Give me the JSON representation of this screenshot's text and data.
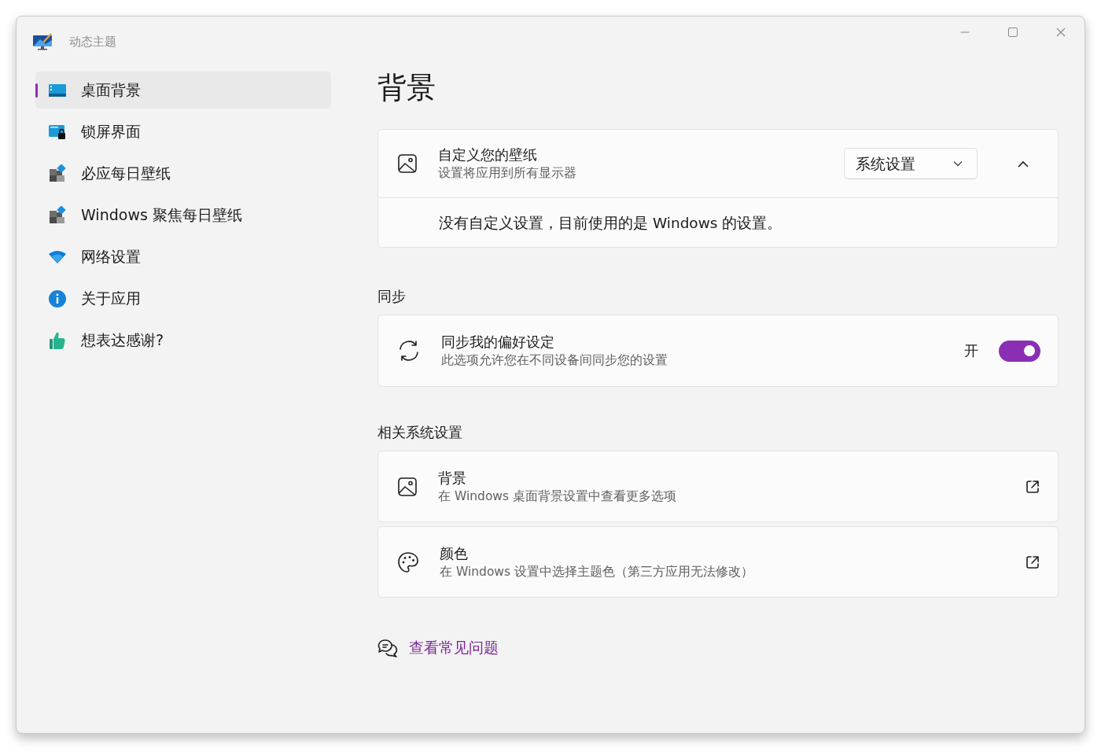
{
  "window": {
    "title": "动态主题"
  },
  "sidebar": {
    "items": [
      {
        "label": "桌面背景",
        "selected": true
      },
      {
        "label": "锁屏界面",
        "selected": false
      },
      {
        "label": "必应每日壁纸",
        "selected": false
      },
      {
        "label": "Windows 聚焦每日壁纸",
        "selected": false
      },
      {
        "label": "网络设置",
        "selected": false
      },
      {
        "label": "关于应用",
        "selected": false
      },
      {
        "label": "想表达感谢?",
        "selected": false
      }
    ]
  },
  "page": {
    "title": "背景"
  },
  "wallpaper_card": {
    "title": "自定义您的壁纸",
    "subtitle": "设置将应用到所有显示器",
    "dropdown": {
      "value": "系统设置"
    },
    "expanded": true,
    "message": "没有自定义设置，目前使用的是 Windows 的设置。"
  },
  "sync_section": {
    "heading": "同步",
    "title": "同步我的偏好设定",
    "subtitle": "此选项允许您在不同设备间同步您的设置",
    "toggle": {
      "label": "开",
      "on": true
    }
  },
  "related_section": {
    "heading": "相关系统设置",
    "links": [
      {
        "title": "背景",
        "subtitle": "在 Windows 桌面背景设置中查看更多选项"
      },
      {
        "title": "颜色",
        "subtitle": "在 Windows 设置中选择主题色（第三方应用无法修改）"
      }
    ]
  },
  "faq_link": "查看常见问题"
}
